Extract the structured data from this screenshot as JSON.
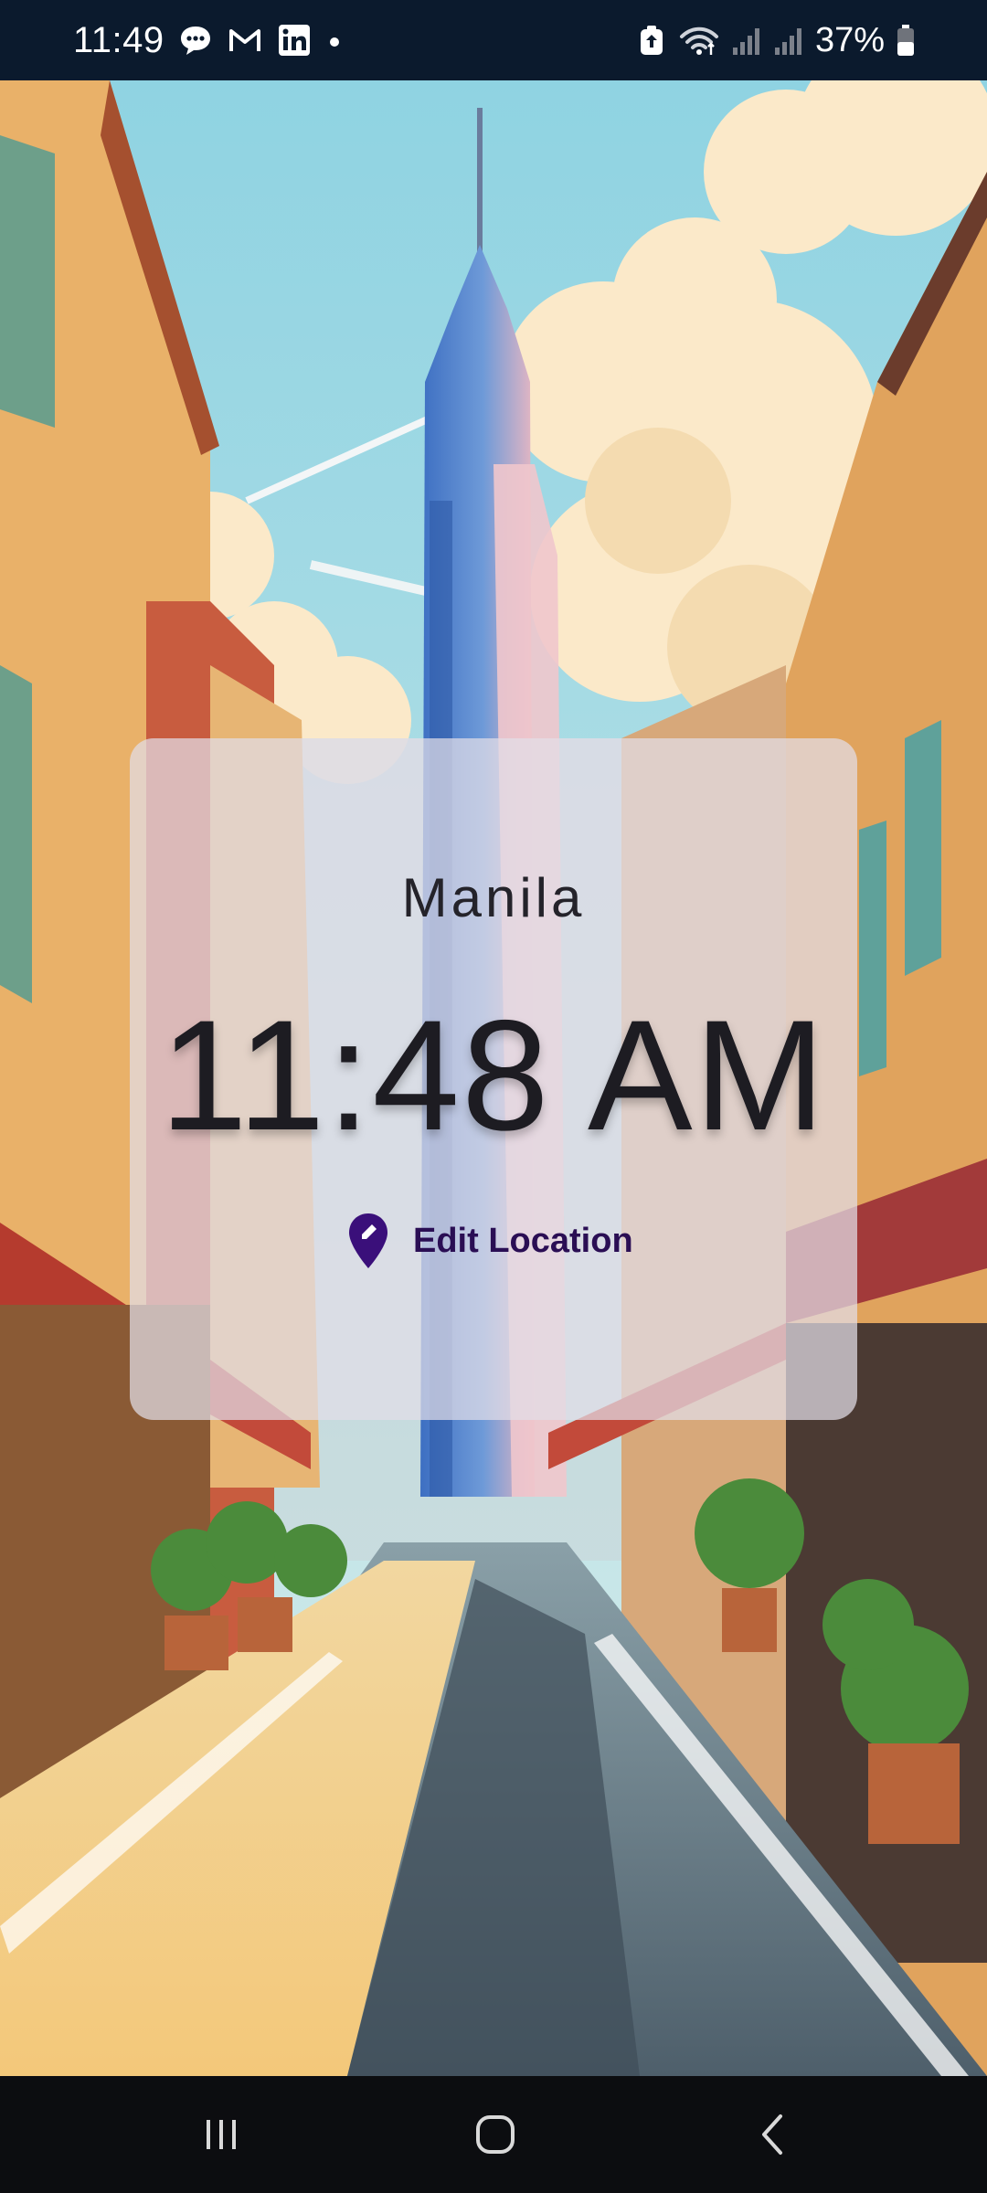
{
  "status_bar": {
    "time": "11:49",
    "battery": "37%",
    "notification_icons": [
      "chat-bubble-icon",
      "gmail-icon",
      "linkedin-icon",
      "dot-icon"
    ],
    "system_icons": [
      "data-saver-icon",
      "wifi-icon",
      "signal-icon",
      "signal-icon",
      "battery-icon"
    ]
  },
  "card": {
    "city": "Manila",
    "time": "11:48 AM",
    "edit_label": "Edit Location",
    "edit_icon": "location-edit-icon"
  },
  "colors": {
    "status_bar_bg": "#0b1a2d",
    "card_bg": "#e2dee8",
    "accent": "#3a0f7a",
    "nav_bg": "#0c0d10"
  },
  "nav_bar": {
    "buttons": [
      "recent-apps-icon",
      "home-icon",
      "back-icon"
    ]
  }
}
